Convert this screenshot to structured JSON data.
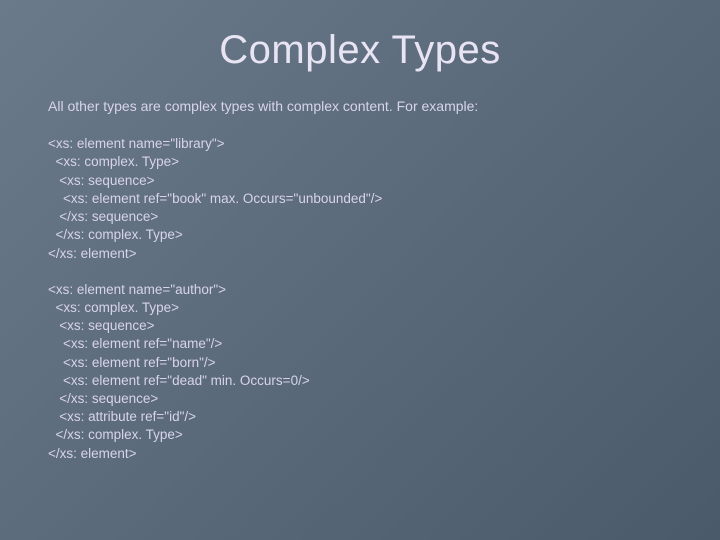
{
  "title": "Complex Types",
  "intro": "All other types are complex types with complex content. For example:",
  "code_library": "<xs: element name=\"library\">\n  <xs: complex. Type>\n   <xs: sequence>\n    <xs: element ref=\"book\" max. Occurs=\"unbounded\"/>\n   </xs: sequence>\n  </xs: complex. Type>\n</xs: element>",
  "code_author": "<xs: element name=\"author\">\n  <xs: complex. Type>\n   <xs: sequence>\n    <xs: element ref=\"name\"/>\n    <xs: element ref=\"born\"/>\n    <xs: element ref=\"dead\" min. Occurs=0/>\n   </xs: sequence>\n   <xs: attribute ref=\"id\"/>\n  </xs: complex. Type>\n</xs: element>"
}
